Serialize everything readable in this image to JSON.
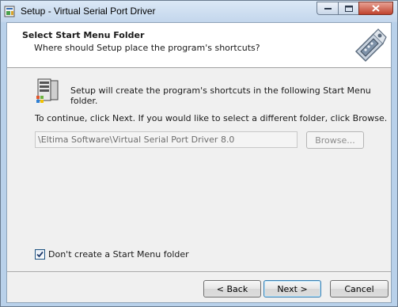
{
  "window": {
    "title": "Setup - Virtual Serial Port Driver"
  },
  "header": {
    "title": "Select Start Menu Folder",
    "subtitle": "Where should Setup place the program's shortcuts?",
    "icon": "serial-port-connector-icon"
  },
  "body": {
    "icon": "program-group-icon",
    "line1": "Setup will create the program's shortcuts in the following Start Menu folder.",
    "line2": "To continue, click Next. If you would like to select a different folder, click Browse.",
    "folder_value": "\\Eltima Software\\Virtual Serial Port Driver 8.0",
    "browse_label": "Browse...",
    "checkbox_label": "Don't create a Start Menu folder",
    "checkbox_checked": true
  },
  "footer": {
    "back_label": "< Back",
    "next_label": "Next >",
    "cancel_label": "Cancel"
  }
}
